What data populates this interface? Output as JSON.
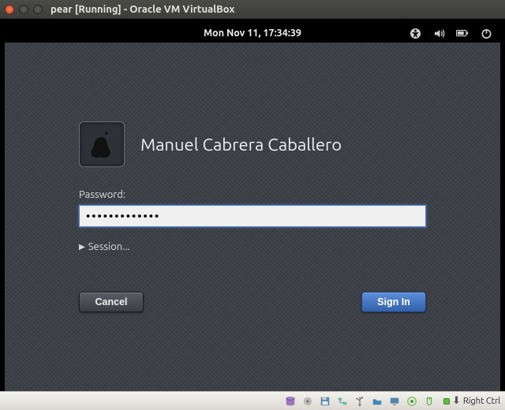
{
  "host": {
    "title": "pear [Running] - Oracle VM VirtualBox"
  },
  "guestMenu": {
    "clock": "Mon Nov 11, 17:34:39"
  },
  "login": {
    "username": "Manuel Cabrera Caballero",
    "passwordLabel": "Password:",
    "passwordValue": "●●●●●●●●●●●●●",
    "sessionLabel": "Session...",
    "cancel": "Cancel",
    "signIn": "Sign In"
  },
  "statusbar": {
    "hostKey": "Right Ctrl"
  }
}
